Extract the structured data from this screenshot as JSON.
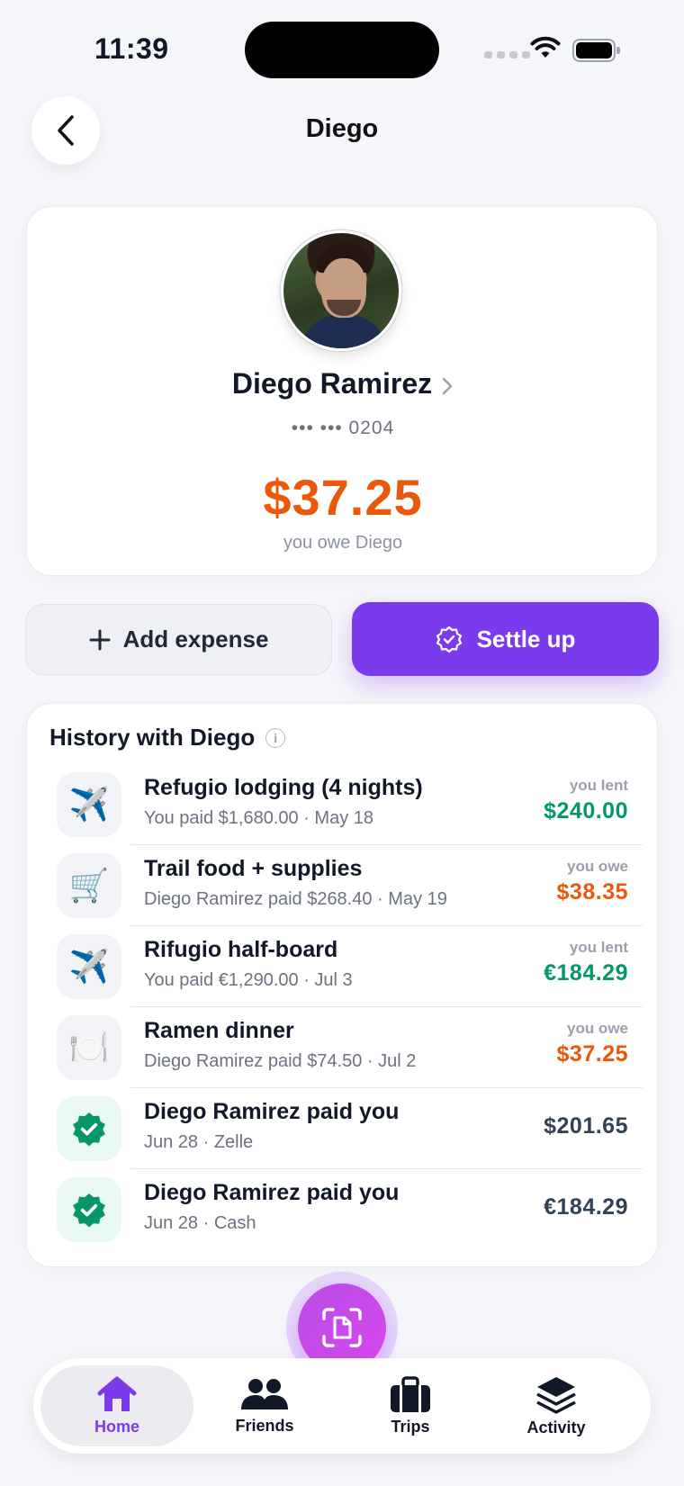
{
  "status": {
    "time": "11:39"
  },
  "header": {
    "title": "Diego"
  },
  "profile": {
    "name": "Diego Ramirez",
    "account": "••• ••• 0204",
    "balance": "$37.25",
    "balance_caption": "you owe Diego"
  },
  "actions": {
    "add_expense": "Add expense",
    "settle_up": "Settle up"
  },
  "history": {
    "title": "History with Diego",
    "items": [
      {
        "icon": "airplane-icon",
        "glyph": "✈️",
        "title": "Refugio lodging (4 nights)",
        "subtitle": "You paid $1,680.00 · May 18",
        "label": "you lent",
        "amount": "$240.00",
        "kind": "lent"
      },
      {
        "icon": "cart-icon",
        "glyph": "🛒",
        "title": "Trail food + supplies",
        "subtitle": "Diego Ramirez paid $268.40 · May 19",
        "label": "you owe",
        "amount": "$38.35",
        "kind": "owe"
      },
      {
        "icon": "airplane-icon",
        "glyph": "✈️",
        "title": "Rifugio half-board",
        "subtitle": "You paid €1,290.00 · Jul 3",
        "label": "you lent",
        "amount": "€184.29",
        "kind": "lent"
      },
      {
        "icon": "plate-icon",
        "glyph": "🍽️",
        "title": "Ramen dinner",
        "subtitle": "Diego Ramirez paid $74.50 · Jul 2",
        "label": "you owe",
        "amount": "$37.25",
        "kind": "owe"
      },
      {
        "icon": "verified-check-icon",
        "title": "Diego Ramirez paid you",
        "subtitle": "Jun 28 · Zelle",
        "label": "",
        "amount": "$201.65",
        "kind": "settled"
      },
      {
        "icon": "verified-check-icon",
        "title": "Diego Ramirez paid you",
        "subtitle": "Jun 28 · Cash",
        "label": "",
        "amount": "€184.29",
        "kind": "settled"
      }
    ]
  },
  "tabs": [
    {
      "label": "Home",
      "icon": "home-icon",
      "active": true
    },
    {
      "label": "Friends",
      "icon": "friends-icon",
      "active": false
    },
    {
      "label": "Trips",
      "icon": "briefcase-icon",
      "active": false
    },
    {
      "label": "Activity",
      "icon": "layers-icon",
      "active": false
    }
  ],
  "colors": {
    "accent": "#7c3aed",
    "owe": "#ea580c",
    "lent": "#059669"
  }
}
